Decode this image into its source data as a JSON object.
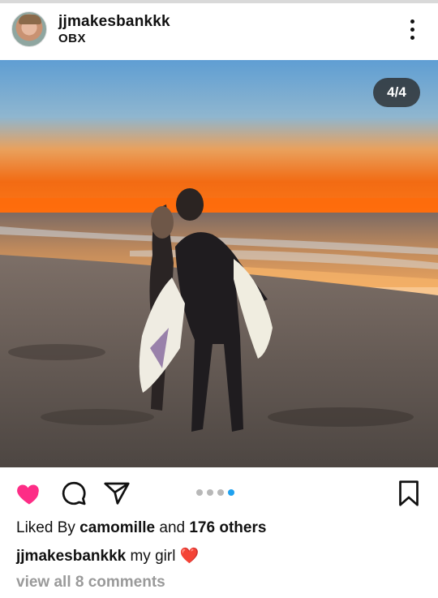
{
  "post": {
    "username": "jjmakesbankkk",
    "location": "OBX",
    "photo_counter": "4/4",
    "carousel": {
      "total": 4,
      "active": 4
    },
    "liked_by_prefix": "Liked By",
    "liked_by_user": "camomille",
    "liked_by_and": "and",
    "liked_by_others": "176 others",
    "caption_user": "jjmakesbankkk",
    "caption_text": "my girl",
    "caption_emoji": "❤️",
    "view_comments": "view all 8 comments"
  },
  "icons": {
    "more": "more-vertical-icon",
    "like": "heart-filled-icon",
    "comment": "comment-bubble-icon",
    "share": "paper-plane-icon",
    "save": "bookmark-icon"
  },
  "colors": {
    "like_active": "#fd2d86",
    "carousel_active": "#1fa1ef",
    "carousel_inactive": "#b8b8b8",
    "muted_text": "#9a9a9a"
  }
}
